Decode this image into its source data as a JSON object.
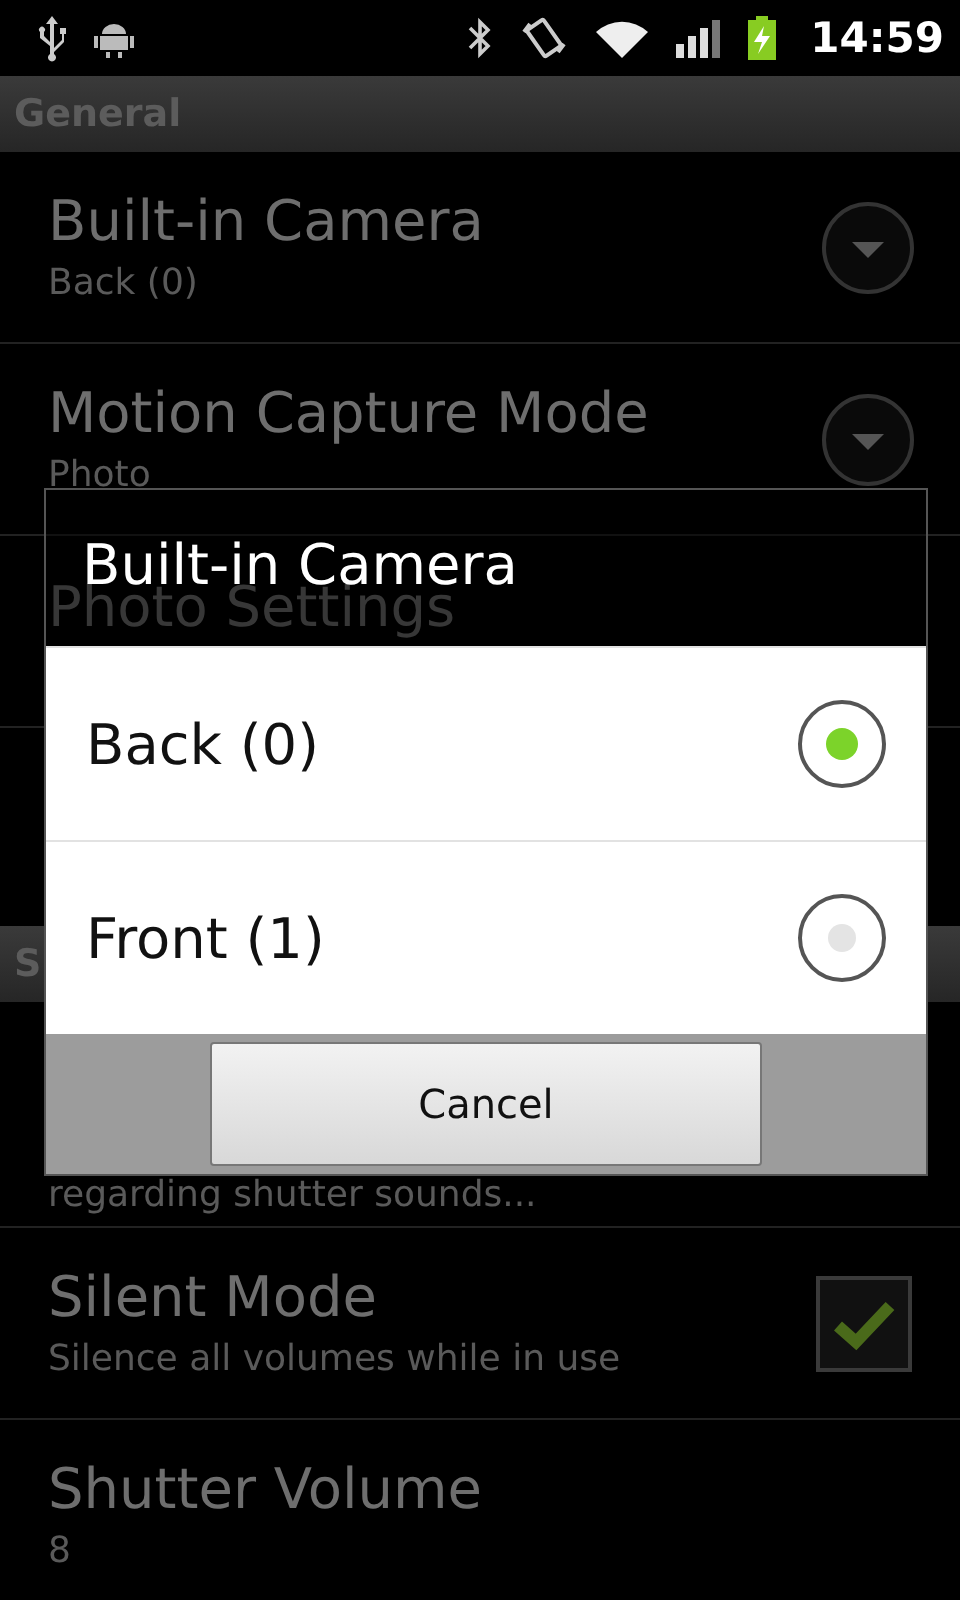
{
  "status_bar": {
    "time": "14:59"
  },
  "preferences": [
    {
      "kind": "header",
      "title": "General"
    },
    {
      "kind": "dropdown",
      "title": "Built-in Camera",
      "summary": "Back (0)"
    },
    {
      "kind": "dropdown",
      "title": "Motion Capture Mode",
      "summary": "Photo"
    },
    {
      "kind": "plain",
      "title": "Photo Settings"
    },
    {
      "kind": "header",
      "title": "S"
    },
    {
      "kind": "plain",
      "summary": "regarding shutter sounds..."
    },
    {
      "kind": "checkbox",
      "title": "Silent Mode",
      "summary": "Silence all volumes while in use",
      "checked": true
    },
    {
      "kind": "plain",
      "title": "Shutter Volume",
      "summary": "8"
    }
  ],
  "dialog": {
    "title": "Built-in Camera",
    "options": [
      {
        "label": "Back (0)",
        "selected": true
      },
      {
        "label": "Front (1)",
        "selected": false
      }
    ],
    "button": "Cancel"
  }
}
